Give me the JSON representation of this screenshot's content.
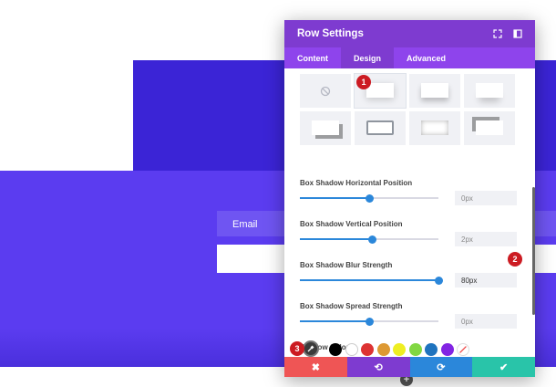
{
  "modal": {
    "title": "Row Settings",
    "tabs": [
      {
        "label": "Content",
        "active": false
      },
      {
        "label": "Design",
        "active": true
      },
      {
        "label": "Advanced",
        "active": false
      }
    ],
    "header_icons": [
      "expand-icon",
      "sidebar-icon"
    ]
  },
  "settings": [
    {
      "label": "Box Shadow Horizontal Position",
      "value": "0px",
      "level": 0.5
    },
    {
      "label": "Box Shadow Vertical Position",
      "value": "2px",
      "level": 0.52
    },
    {
      "label": "Box Shadow Blur Strength",
      "value": "80px",
      "level": 1.0
    },
    {
      "label": "Box Shadow Spread Strength",
      "value": "0px",
      "level": 0.5
    }
  ],
  "shadow_color": {
    "label": "Shadow Color",
    "swatches": [
      "#000000",
      "#ffffff",
      "#dd3333",
      "#dd9933",
      "#eeee22",
      "#81d742",
      "#1e73be",
      "#8224e3"
    ]
  },
  "footer": {
    "buttons": [
      {
        "label": "✖",
        "color": "#ef5555"
      },
      {
        "label": "⟲",
        "color": "#7e3bd0"
      },
      {
        "label": "⟳",
        "color": "#2b87da"
      },
      {
        "label": "✔",
        "color": "#29c4a9"
      }
    ]
  },
  "page": {
    "email_label": "Email"
  },
  "annotations": [
    "1",
    "2",
    "3"
  ],
  "colors": {
    "header": "#7e3bd0",
    "tabs": "#8e44ec",
    "accent": "#2b87da",
    "badge": "#cc1b22",
    "page_bg": "#5b3cf0"
  }
}
